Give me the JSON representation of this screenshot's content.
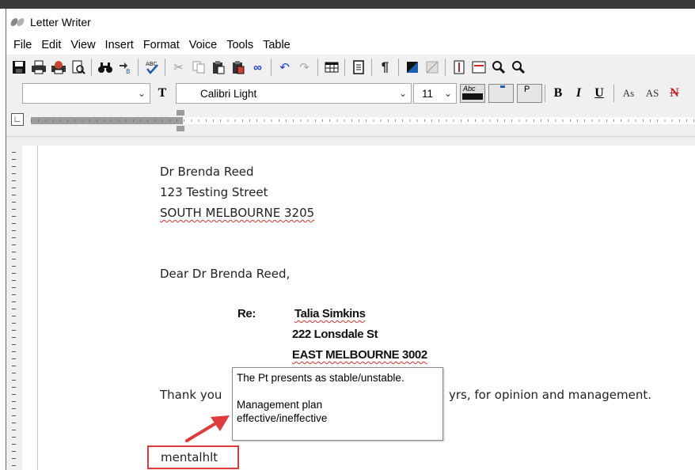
{
  "window": {
    "title": "Letter Writer"
  },
  "menu": [
    "File",
    "Edit",
    "View",
    "Insert",
    "Format",
    "Voice",
    "Tools",
    "Table"
  ],
  "toolbar": {
    "icons": [
      "save-icon",
      "print-icon",
      "print-setup-icon",
      "print-preview-icon",
      "find-icon",
      "replace-icon",
      "spell-check-icon",
      "cut-icon",
      "copy-icon",
      "paste-icon",
      "paste-special-icon",
      "link-icon",
      "undo-icon",
      "redo-icon",
      "table-icon",
      "document-icon",
      "pilcrow-icon",
      "color-fill-icon",
      "gradient-icon",
      "page-height-icon",
      "page-width-icon",
      "zoom-in-icon",
      "zoom-out-icon"
    ]
  },
  "format": {
    "style_value": "",
    "font_name": "Calibri Light",
    "font_size": "11",
    "bold_label": "B",
    "italic_label": "I",
    "underline_label": "U",
    "subscript_label": "As",
    "superscript_label": "AS",
    "highlight_label": "Abc",
    "font_color_label": "P"
  },
  "letter": {
    "addr_name": "Dr Brenda Reed",
    "addr_street": "123 Testing Street",
    "addr_city": "SOUTH MELBOURNE 3205",
    "salutation": "Dear Dr Brenda Reed,",
    "re_label": "Re:",
    "patient_name": "Talia Simkins",
    "patient_street": "222 Lonsdale St",
    "patient_city": "EAST MELBOURNE 3002",
    "body_start": "Thank you",
    "body_end": "yrs, for opinion and management.",
    "typed_text": "mentalhlt"
  },
  "tooltip": {
    "line1": "The Pt presents as stable/unstable.",
    "line2": "Management plan",
    "line3": "effective/ineffective"
  },
  "colors": {
    "annotation_red": "#e03a3a",
    "spell_underline": "#e0302a"
  }
}
